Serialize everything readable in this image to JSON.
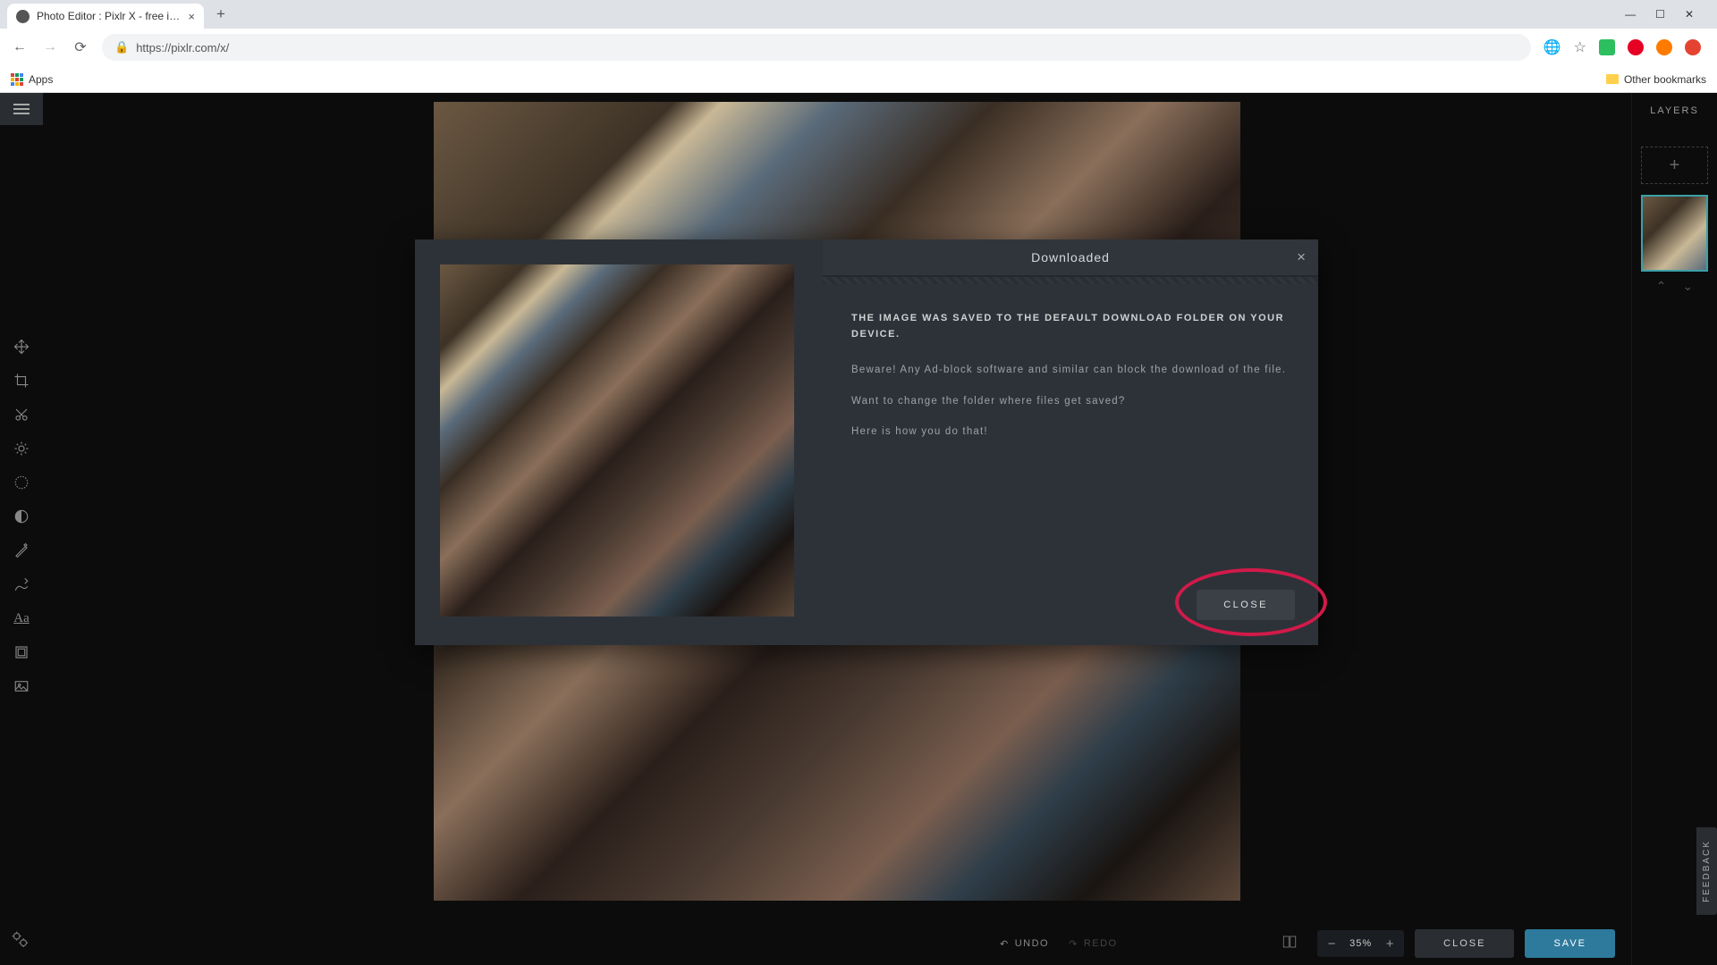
{
  "browser": {
    "tab_title": "Photo Editor : Pixlr X - free image",
    "url": "https://pixlr.com/x/",
    "bookmarks": {
      "apps": "Apps",
      "other": "Other bookmarks"
    }
  },
  "layers": {
    "header": "LAYERS"
  },
  "bottombar": {
    "undo": "UNDO",
    "redo": "REDO",
    "zoom": "35%",
    "close": "CLOSE",
    "save": "SAVE"
  },
  "feedback": "FEEDBACK",
  "modal": {
    "title": "Downloaded",
    "heading": "THE IMAGE WAS SAVED TO THE DEFAULT DOWNLOAD FOLDER ON YOUR DEVICE.",
    "warn": "Beware! Any Ad-block software and similar can block the download of the file.",
    "q": "Want to change the folder where files get saved?",
    "how": "Here is how you do that!",
    "close": "CLOSE"
  }
}
